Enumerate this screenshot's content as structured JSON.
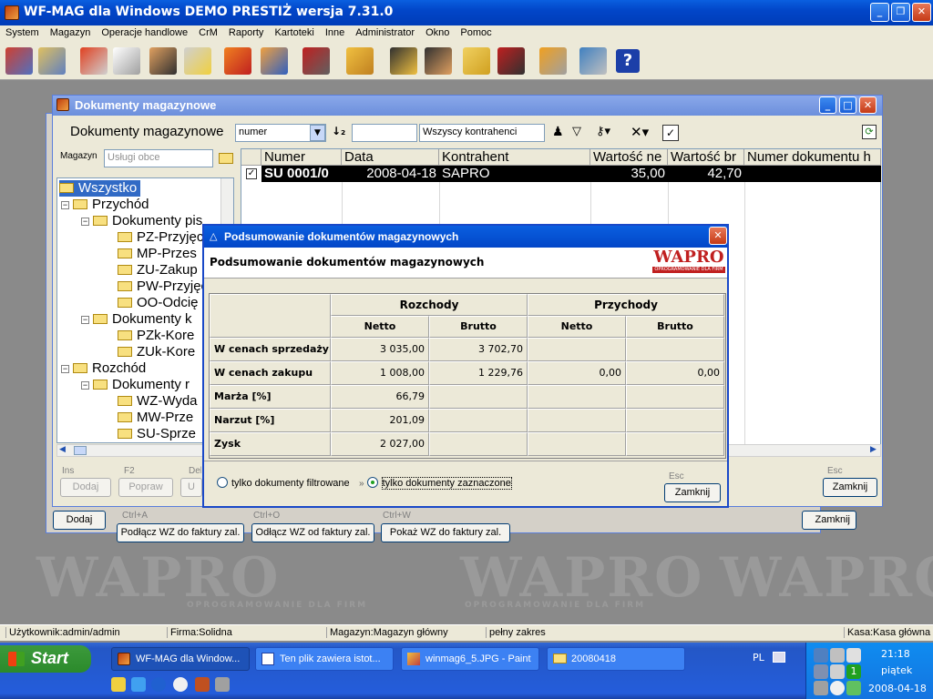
{
  "app": {
    "title": "WF-MAG dla Windows DEMO PRESTIŻ  wersja 7.31.0",
    "menu": [
      "System",
      "Magazyn",
      "Operacje handlowe",
      "CrM",
      "Raporty",
      "Kartoteki",
      "Inne",
      "Administrator",
      "Okno",
      "Pomoc"
    ]
  },
  "watermark": {
    "brand": "WAPRO",
    "tagline": "OPROGRAMOWANIE DLA FIRM"
  },
  "docwin": {
    "title": "Dokumenty magazynowe",
    "header_label": "Dokumenty magazynowe",
    "sort_field": "numer",
    "search_value": "",
    "contractor_filter": "Wszyscy kontrahenci",
    "magazyn_label": "Magazyn",
    "magazyn_value": "Usługi obce",
    "tree": [
      {
        "label": "Wszystko"
      },
      {
        "label": "Przychód"
      },
      {
        "label": "Dokumenty pis"
      },
      {
        "label": "PZ-Przyjęcie"
      },
      {
        "label": "MP-Przes"
      },
      {
        "label": "ZU-Zakup"
      },
      {
        "label": "PW-Przyjęcie"
      },
      {
        "label": "OO-Odcię"
      },
      {
        "label": "Dokumenty k"
      },
      {
        "label": "PZk-Kore"
      },
      {
        "label": "ZUk-Kore"
      },
      {
        "label": "Rozchód"
      },
      {
        "label": "Dokumenty r"
      },
      {
        "label": "WZ-Wyda"
      },
      {
        "label": "MW-Prze"
      },
      {
        "label": "SU-Sprze"
      }
    ],
    "columns": [
      "Numer",
      "Data",
      "Kontrahent",
      "Wartość ne",
      "Wartość br",
      "Numer dokumentu h"
    ],
    "row": {
      "numer": "SU 0001/0",
      "data": "2008-04-18",
      "kontrahent": "SAPRO",
      "netto": "35,00",
      "brutto": "42,70",
      "numer_dok": ""
    },
    "buttons": {
      "dodaj": {
        "key": "Ins",
        "label": "Dodaj"
      },
      "popraw": {
        "key": "F2",
        "label": "Popraw"
      },
      "usun": {
        "key": "Del",
        "label": "U"
      },
      "zamknij": {
        "key": "Esc",
        "label": "Zamknij"
      }
    }
  },
  "backwin": {
    "dodaj": {
      "key": "Ins",
      "label": "Dodaj"
    },
    "zamknij": {
      "label": "Zamknij"
    },
    "podlacz": {
      "key": "Ctrl+A",
      "label": "Podłącz WZ do faktury zal."
    },
    "odlacz": {
      "key": "Ctrl+O",
      "label": "Odłącz WZ od faktury zal."
    },
    "pokaz": {
      "key": "Ctrl+W",
      "label": "Pokaż WZ do faktury zal."
    }
  },
  "dialog": {
    "title": "Podsumowanie dokumentów magazynowych",
    "heading": "Podsumowanie dokumentów magazynowych",
    "logo": "WAPRO",
    "logo_tag": "OPROGRAMOWANIE DLA FIRM",
    "groups": [
      "Rozchody",
      "Przychody"
    ],
    "sub": [
      "Netto",
      "Brutto",
      "Netto",
      "Brutto"
    ],
    "rows": [
      {
        "label": "W cenach sprzedaży",
        "values": [
          "3 035,00",
          "3 702,70",
          "",
          ""
        ]
      },
      {
        "label": "W cenach zakupu",
        "values": [
          "1 008,00",
          "1 229,76",
          "0,00",
          "0,00"
        ]
      },
      {
        "label": "Marża [%]",
        "values": [
          "66,79",
          "",
          "",
          ""
        ]
      },
      {
        "label": "Narzut [%]",
        "values": [
          "201,09",
          "",
          "",
          ""
        ]
      },
      {
        "label": "Zysk",
        "values": [
          "2 027,00",
          "",
          "",
          ""
        ]
      }
    ],
    "radio_filtered": "tylko dokumenty filtrowane",
    "radio_selected": "tylko dokumenty zaznaczone",
    "close_key": "Esc",
    "close_label": "Zamknij"
  },
  "status": {
    "user": "Użytkownik:admin/admin",
    "firma": "Firma:Solidna",
    "magazyn": "Magazyn:Magazyn główny",
    "zakres": "pełny zakres",
    "kasa": "Kasa:Kasa główna"
  },
  "taskbar": {
    "start": "Start",
    "tasks": [
      "WF-MAG dla Window...",
      "Ten plik zawiera istot...",
      "winmag6_5.JPG - Paint",
      "20080418"
    ],
    "lang": "PL",
    "time": "21:18",
    "day": "piątek",
    "date": "2008-04-18"
  }
}
